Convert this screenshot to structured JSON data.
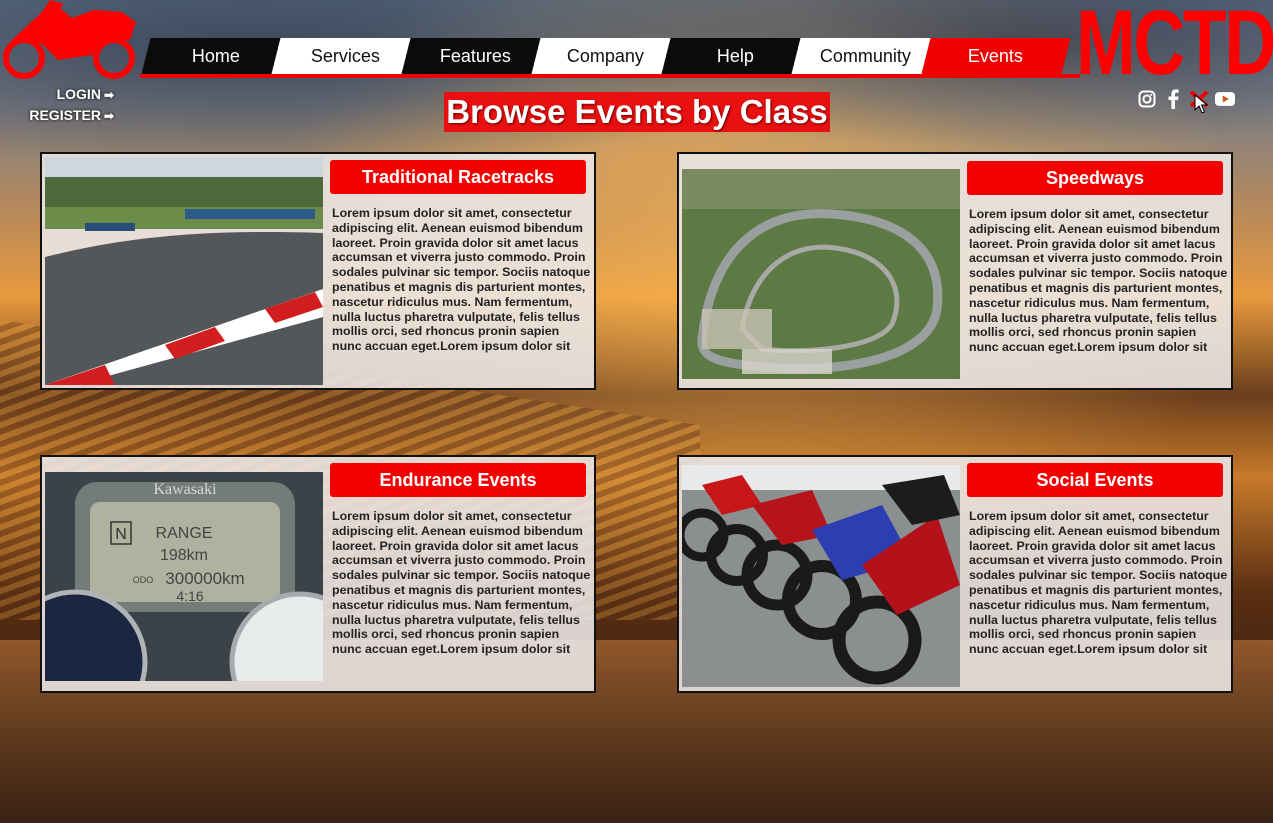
{
  "brand": {
    "name": "MCTD"
  },
  "auth": {
    "login": "LOGIN",
    "register": "REGISTER",
    "arrow_icon": "sign-in-icon"
  },
  "nav": {
    "items": [
      {
        "label": "Home"
      },
      {
        "label": "Services"
      },
      {
        "label": "Features"
      },
      {
        "label": "Company"
      },
      {
        "label": "Help"
      },
      {
        "label": "Community"
      },
      {
        "label": "Events"
      }
    ],
    "active": "Events"
  },
  "socials": [
    "instagram-icon",
    "facebook-icon",
    "twitter-icon",
    "youtube-icon"
  ],
  "page": {
    "title": "Browse Events by Class"
  },
  "cards": [
    {
      "title": "Traditional Racetracks",
      "body": "Lorem ipsum dolor sit amet, consectetur adipiscing elit. Aenean euismod bibendum laoreet. Proin gravida dolor sit amet lacus accumsan et viverra justo commodo. Proin sodales pulvinar sic tempor. Sociis natoque penatibus et magnis dis parturient montes, nascetur ridiculus mus. Nam fermentum, nulla luctus pharetra vulputate, felis tellus mollis orci, sed rhoncus pronin sapien nunc accuan eget.Lorem ipsum dolor sit"
    },
    {
      "title": "Speedways",
      "body": "Lorem ipsum dolor sit amet, consectetur adipiscing elit. Aenean euismod bibendum laoreet. Proin gravida dolor sit amet lacus accumsan et viverra justo commodo. Proin sodales pulvinar sic tempor. Sociis natoque penatibus et magnis dis parturient montes, nascetur ridiculus mus. Nam fermentum, nulla luctus pharetra vulputate, felis tellus mollis orci, sed rhoncus pronin sapien nunc accuan eget.Lorem ipsum dolor sit"
    },
    {
      "title": "Endurance Events",
      "body": "Lorem ipsum dolor sit amet, consectetur adipiscing elit. Aenean euismod bibendum laoreet. Proin gravida dolor sit amet lacus accumsan et viverra justo commodo. Proin sodales pulvinar sic tempor. Sociis natoque penatibus et magnis dis parturient montes, nascetur ridiculus mus. Nam fermentum, nulla luctus pharetra vulputate, felis tellus mollis orci, sed rhoncus pronin sapien nunc accuan eget.Lorem ipsum dolor sit",
      "dash": {
        "gear": "N",
        "mode": "RANGE",
        "range": "198km",
        "odo_label": "ODO",
        "odo": "300000km",
        "clock": "4:16",
        "brand": "Kawasaki"
      }
    },
    {
      "title": "Social Events",
      "body": "Lorem ipsum dolor sit amet, consectetur adipiscing elit. Aenean euismod bibendum laoreet. Proin gravida dolor sit amet lacus accumsan et viverra justo commodo. Proin sodales pulvinar sic tempor. Sociis natoque penatibus et magnis dis parturient montes, nascetur ridiculus mus. Nam fermentum, nulla luctus pharetra vulputate, felis tellus mollis orci, sed rhoncus pronin sapien nunc accuan eget.Lorem ipsum dolor sit"
    }
  ],
  "colors": {
    "accent": "#f00000",
    "nav_dark": "#0b0b0b",
    "nav_light": "#ffffff"
  }
}
